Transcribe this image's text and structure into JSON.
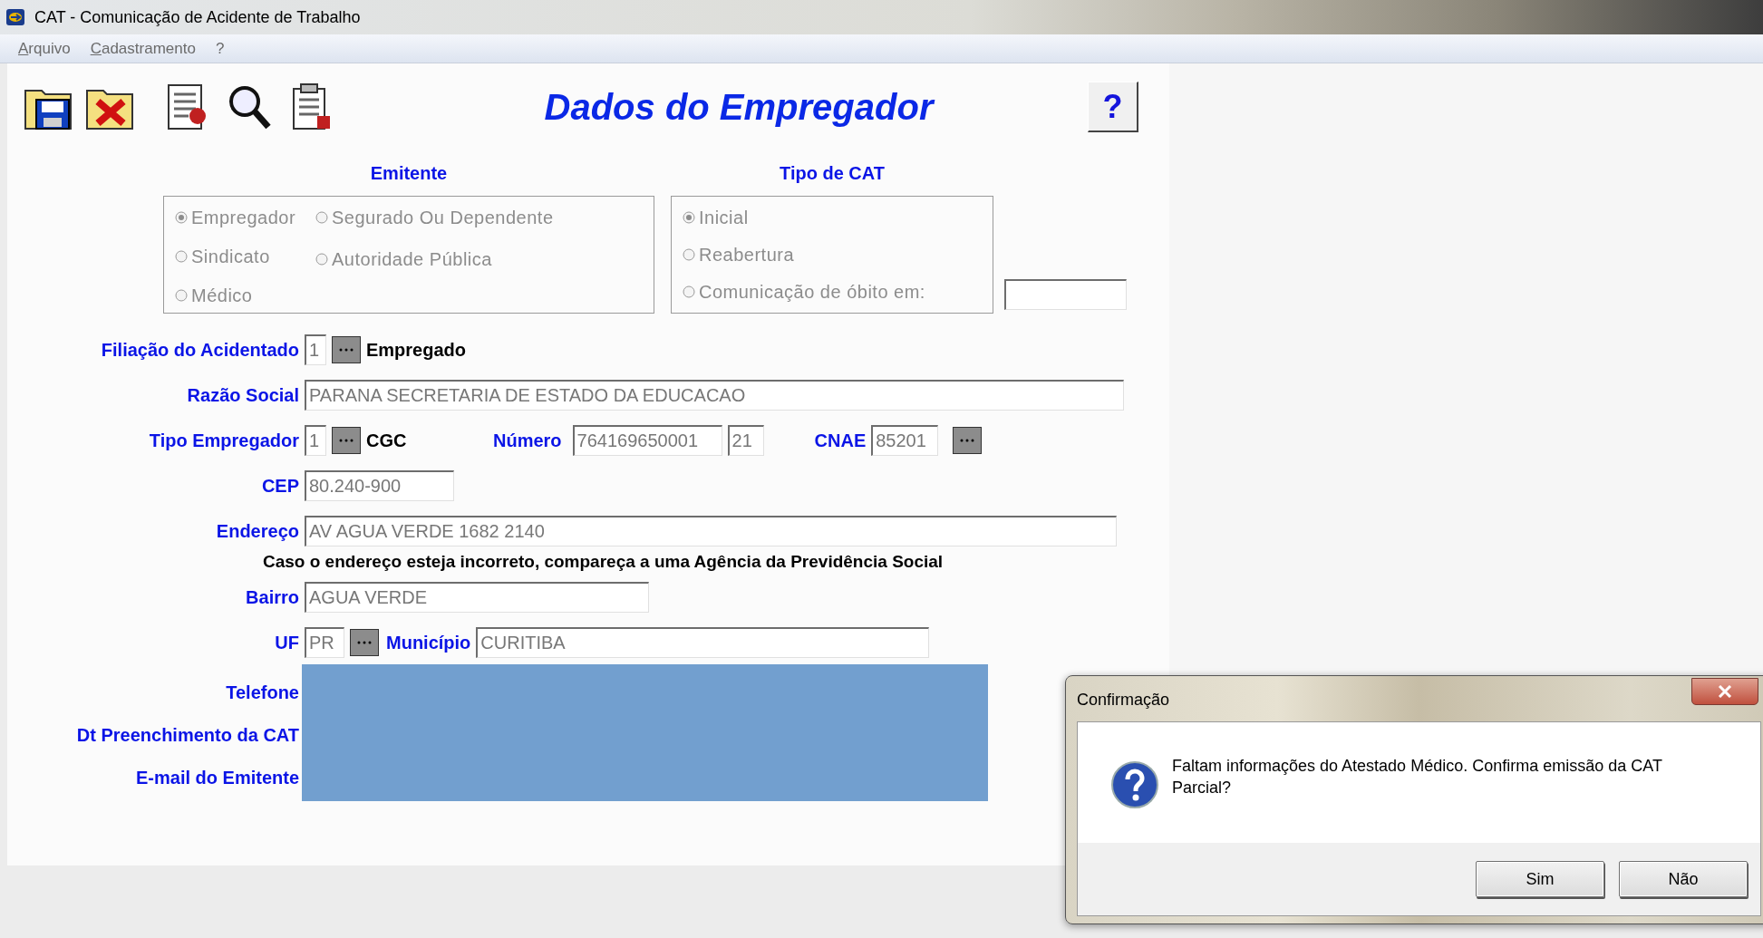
{
  "window": {
    "title": "CAT - Comunicação de Acidente de Trabalho"
  },
  "menu": [
    {
      "label": "Arquivo"
    },
    {
      "label": "Cadastramento"
    },
    {
      "label": "?"
    }
  ],
  "heading": "Dados do Empregador",
  "help_button": "?",
  "emitente": {
    "title": "Emitente",
    "disabled": true,
    "options": [
      {
        "label": "Empregador",
        "selected": true
      },
      {
        "label": "Segurado Ou Dependente",
        "selected": false
      },
      {
        "label": "Sindicato",
        "selected": false
      },
      {
        "label": "Autoridade Pública",
        "selected": false
      },
      {
        "label": "Médico",
        "selected": false
      }
    ]
  },
  "tipo_cat": {
    "title": "Tipo de CAT",
    "disabled": true,
    "options": [
      {
        "label": "Inicial",
        "selected": true
      },
      {
        "label": "Reabertura",
        "selected": false
      },
      {
        "label": "Comunicação de óbito em:",
        "selected": false
      }
    ]
  },
  "filiacao": {
    "label": "Filiação do Acidentado",
    "code": "1",
    "description": "Empregado"
  },
  "razao_social": {
    "label": "Razão Social",
    "value": "PARANA SECRETARIA DE ESTADO DA EDUCACAO"
  },
  "tipo_empregador": {
    "label": "Tipo Empregador",
    "code": "1",
    "description": "CGC"
  },
  "numero": {
    "label": "Número",
    "value": "764169650001",
    "suffix": "21"
  },
  "cnae": {
    "label": "CNAE",
    "value": "85201"
  },
  "cep": {
    "label": "CEP",
    "value": "80.240-900"
  },
  "endereco": {
    "label": "Endereço",
    "value": "AV AGUA VERDE 1682 2140"
  },
  "note": "Caso o endereço esteja incorreto, compareça a uma Agência da Previdência Social",
  "bairro": {
    "label": "Bairro",
    "value": "AGUA VERDE"
  },
  "uf": {
    "label": "UF",
    "value": "PR"
  },
  "municipio": {
    "label": "Município",
    "value": "CURITIBA"
  },
  "redacted_fields": [
    {
      "label": "Telefone"
    },
    {
      "label": "Dt Preenchimento da CAT"
    },
    {
      "label": "E-mail do Emitente"
    }
  ],
  "dialog": {
    "title": "Confirmação",
    "message": "Faltam informações do Atestado Médico. Confirma emissão da CAT Parcial?",
    "buttons": [
      {
        "label": "Sim"
      },
      {
        "label": "Não"
      }
    ]
  }
}
